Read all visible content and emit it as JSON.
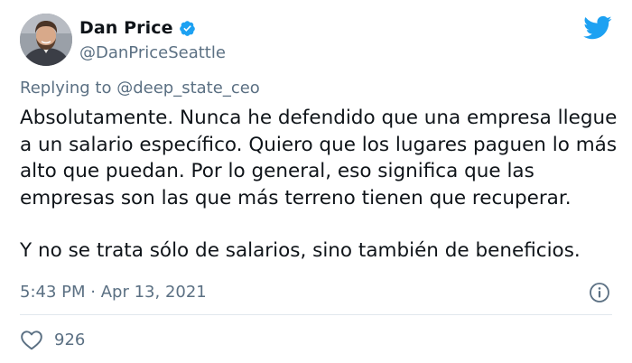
{
  "author": {
    "name": "Dan Price",
    "handle": "@DanPriceSeattle",
    "verified": true
  },
  "reply": {
    "prefix": "Replying to",
    "mention": "@deep_state_ceo"
  },
  "tweet": {
    "paragraph1_lines": [
      "Absolutamente. Nunca he defendido que una empresa llegue",
      "a un salario específico. Quiero que los lugares paguen lo más",
      "alto que puedan. Por lo general, eso significa que las",
      "empresas son las que más terreno tienen que recuperar."
    ],
    "paragraph2": "Y no se trata sólo de salarios, sino también de beneficios."
  },
  "meta": {
    "time": "5:43 PM",
    "separator": "·",
    "date": "Apr 13, 2021"
  },
  "engagement": {
    "likes": "926"
  },
  "colors": {
    "accent": "#1da1f2",
    "secondary_text": "#5b7083",
    "primary_text": "#0f1419",
    "divider": "#e1e8ed"
  },
  "icons": {
    "logo": "twitter-bird-icon",
    "verified": "verified-badge-icon",
    "info": "info-icon",
    "like": "heart-icon"
  }
}
